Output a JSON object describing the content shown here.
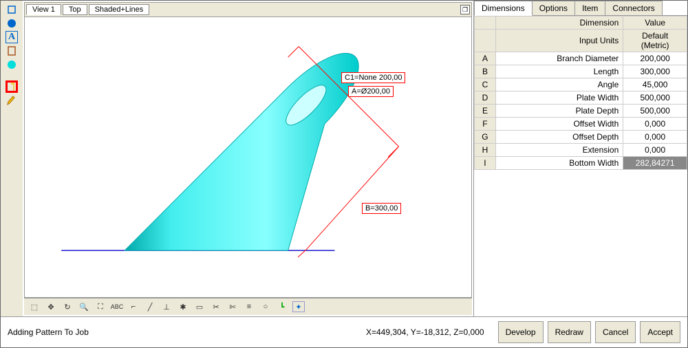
{
  "viewport": {
    "tabs": [
      "View 1",
      "Top",
      "Shaded+Lines"
    ]
  },
  "annotations": {
    "c1": "C1=None 200,00",
    "a": "A=Ø200,00",
    "b": "B=300,00"
  },
  "right_tabs": [
    "Dimensions",
    "Options",
    "Item",
    "Connectors"
  ],
  "grid": {
    "header_dim": "Dimension",
    "header_val": "Value",
    "input_units_label": "Input Units",
    "input_units_value": "Default (Metric)",
    "rows": [
      {
        "key": "A",
        "dim": "Branch Diameter",
        "val": "200,000"
      },
      {
        "key": "B",
        "dim": "Length",
        "val": "300,000"
      },
      {
        "key": "C",
        "dim": "Angle",
        "val": "45,000"
      },
      {
        "key": "D",
        "dim": "Plate Width",
        "val": "500,000"
      },
      {
        "key": "E",
        "dim": "Plate Depth",
        "val": "500,000"
      },
      {
        "key": "F",
        "dim": "Offset Width",
        "val": "0,000"
      },
      {
        "key": "G",
        "dim": "Offset Depth",
        "val": "0,000"
      },
      {
        "key": "H",
        "dim": "Extension",
        "val": "0,000"
      },
      {
        "key": "I",
        "dim": "Bottom Width",
        "val": "282,84271"
      }
    ]
  },
  "status": {
    "left": "Adding Pattern To Job",
    "coords": "X=449,304, Y=-18,312, Z=0,000"
  },
  "buttons": {
    "develop": "Develop",
    "redraw": "Redraw",
    "cancel": "Cancel",
    "accept": "Accept"
  }
}
